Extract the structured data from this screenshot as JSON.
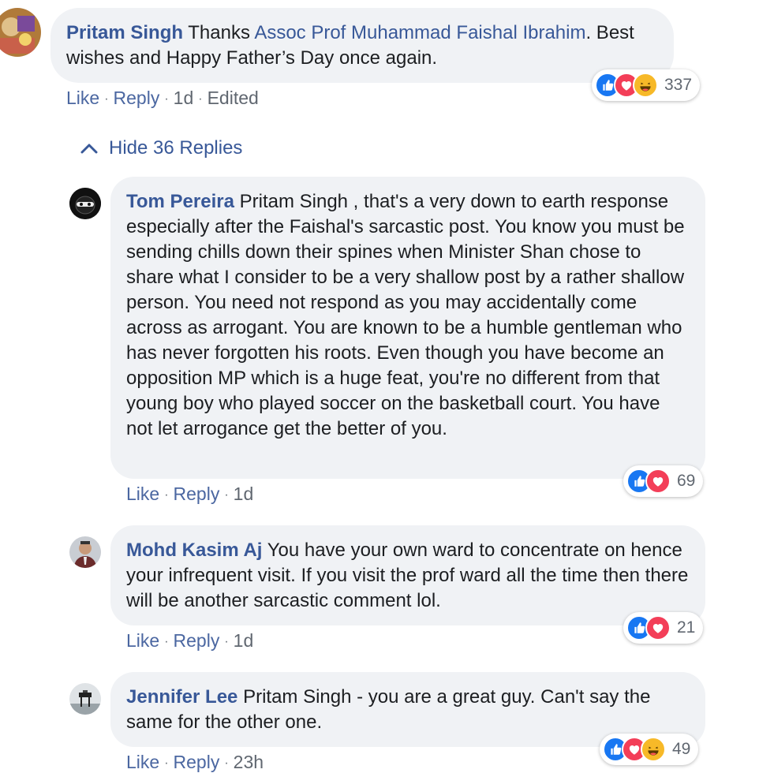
{
  "comments": [
    {
      "author": "Pritam Singh",
      "text_before": "Thanks ",
      "mention": "Assoc Prof Muhammad Faishal Ibrahim",
      "text_after": ". Best wishes and Happy Father’s Day once again.",
      "actions": {
        "like": "Like",
        "reply": "Reply",
        "time": "1d",
        "edited": "Edited"
      },
      "reaction_count": "337",
      "reactions": [
        "like-icon",
        "love-icon",
        "haha-icon"
      ]
    },
    {
      "author": "Tom Pereira",
      "text": "Pritam Singh , that's a very down to earth response especially after the Faishal's sarcastic post. You know you must be sending chills down their spines when Minister Shan chose to share what I consider to be a very shallow post by a rather shallow person. You need not respond as you may accidentally come across as arrogant. You are known to be a humble gentleman who has never forgotten his roots. Even though you have become an opposition MP which is a huge feat, you're no different from that young boy who played soccer on the basketball court. You have not let arrogance get the better of you.",
      "actions": {
        "like": "Like",
        "reply": "Reply",
        "time": "1d"
      },
      "reaction_count": "69",
      "reactions": [
        "like-icon",
        "love-icon"
      ]
    },
    {
      "author": "Mohd Kasim Aj",
      "text": "You have your own ward to concentrate on hence your infrequent visit. If you visit the prof ward all the time then there will be another sarcastic comment lol.",
      "actions": {
        "like": "Like",
        "reply": "Reply",
        "time": "1d"
      },
      "reaction_count": "21",
      "reactions": [
        "like-icon",
        "love-icon"
      ]
    },
    {
      "author": "Jennifer Lee",
      "text": "Pritam Singh - you are a great guy. Can't say the same for the other one.",
      "actions": {
        "like": "Like",
        "reply": "Reply",
        "time": "23h"
      },
      "reaction_count": "49",
      "reactions": [
        "like-icon",
        "love-icon",
        "haha-icon"
      ]
    }
  ],
  "hide_replies": {
    "label": "Hide 36 Replies",
    "icon": "chevron-up-icon"
  },
  "colors": {
    "link": "#385898",
    "bubble": "#f0f2f5",
    "like": "#1877f2",
    "love": "#f33e58",
    "haha": "#f7b928"
  }
}
